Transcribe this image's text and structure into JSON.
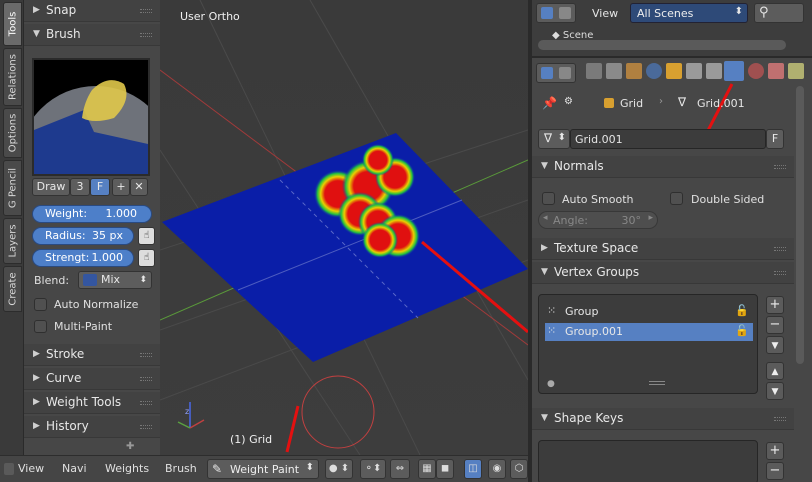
{
  "vertical_tabs": [
    "Tools",
    "Relations",
    "Options",
    "G Pencil",
    "Layers",
    "Create"
  ],
  "shelf": {
    "snap": "Snap",
    "brush": "Brush",
    "draw_label": "Draw",
    "draw_users": "3",
    "fake_user": "F",
    "add": "+",
    "remove": "✕",
    "weight_label": "Weight:",
    "weight_value": "1.000",
    "radius_label": "Radius:",
    "radius_value": "35 px",
    "strength_label": "Strengt:",
    "strength_value": "1.000",
    "blend_label": "Blend:",
    "blend_value": "Mix",
    "auto_normalize": "Auto Normalize",
    "multi_paint": "Multi-Paint",
    "stroke": "Stroke",
    "curve": "Curve",
    "weight_tools": "Weight Tools",
    "history": "History"
  },
  "viewport": {
    "view_name": "User Ortho",
    "object_label": "(1) Grid"
  },
  "bottom_bar": {
    "view": "View",
    "navi": "Navi",
    "weights": "Weights",
    "brush": "Brush",
    "mode": "Weight Paint"
  },
  "outliner": {
    "view": "View",
    "scenes": "All Scenes",
    "scene": "Scene"
  },
  "properties": {
    "breadcrumb_object": "Grid",
    "breadcrumb_mesh": "Grid.001",
    "mesh_name": "Grid.001",
    "mesh_fake": "F",
    "normals": "Normals",
    "auto_smooth": "Auto Smooth",
    "double_sided": "Double Sided",
    "angle_label": "Angle:",
    "angle_value": "30°",
    "texture_space": "Texture Space",
    "vertex_groups": "Vertex Groups",
    "groups": [
      "Group",
      "Group.001"
    ],
    "shape_keys": "Shape Keys"
  },
  "colors": {
    "accent": "#5680c2",
    "paint_low": "#0a14a0",
    "paint_high": "#e01010",
    "annotation": "#e41010"
  }
}
